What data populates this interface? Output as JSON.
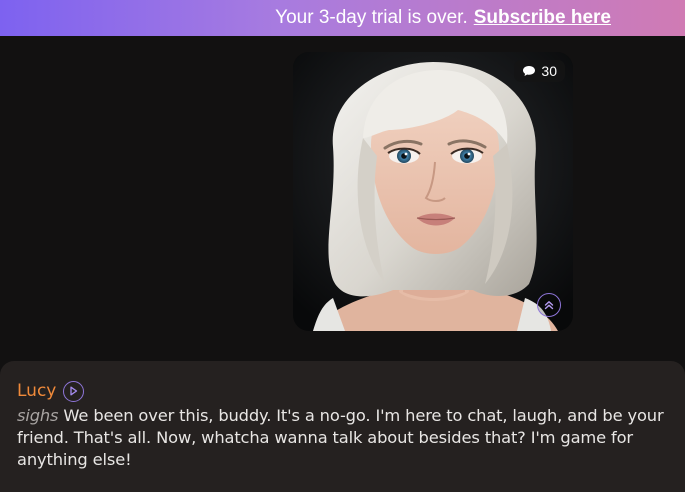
{
  "banner": {
    "text": "Your 3-day trial is over.",
    "link_label": "Subscribe here"
  },
  "card": {
    "comment_icon": "speech-bubble-icon",
    "comment_count": "30",
    "expand_icon": "chevron-up-double-icon"
  },
  "message": {
    "sender": "Lucy",
    "play_icon": "play-icon",
    "action": "sighs",
    "body": " We been over this, buddy. It's a no-go. I'm here to chat, laugh, and be your friend. That's all. Now, whatcha wanna talk about besides that? I'm game for anything else!"
  },
  "colors": {
    "background": "#121111",
    "banner_start": "#7d62f0",
    "banner_end": "#d07bb4",
    "message_panel": "#252120",
    "name": "#f08a3a",
    "accent": "#8e75d8"
  }
}
